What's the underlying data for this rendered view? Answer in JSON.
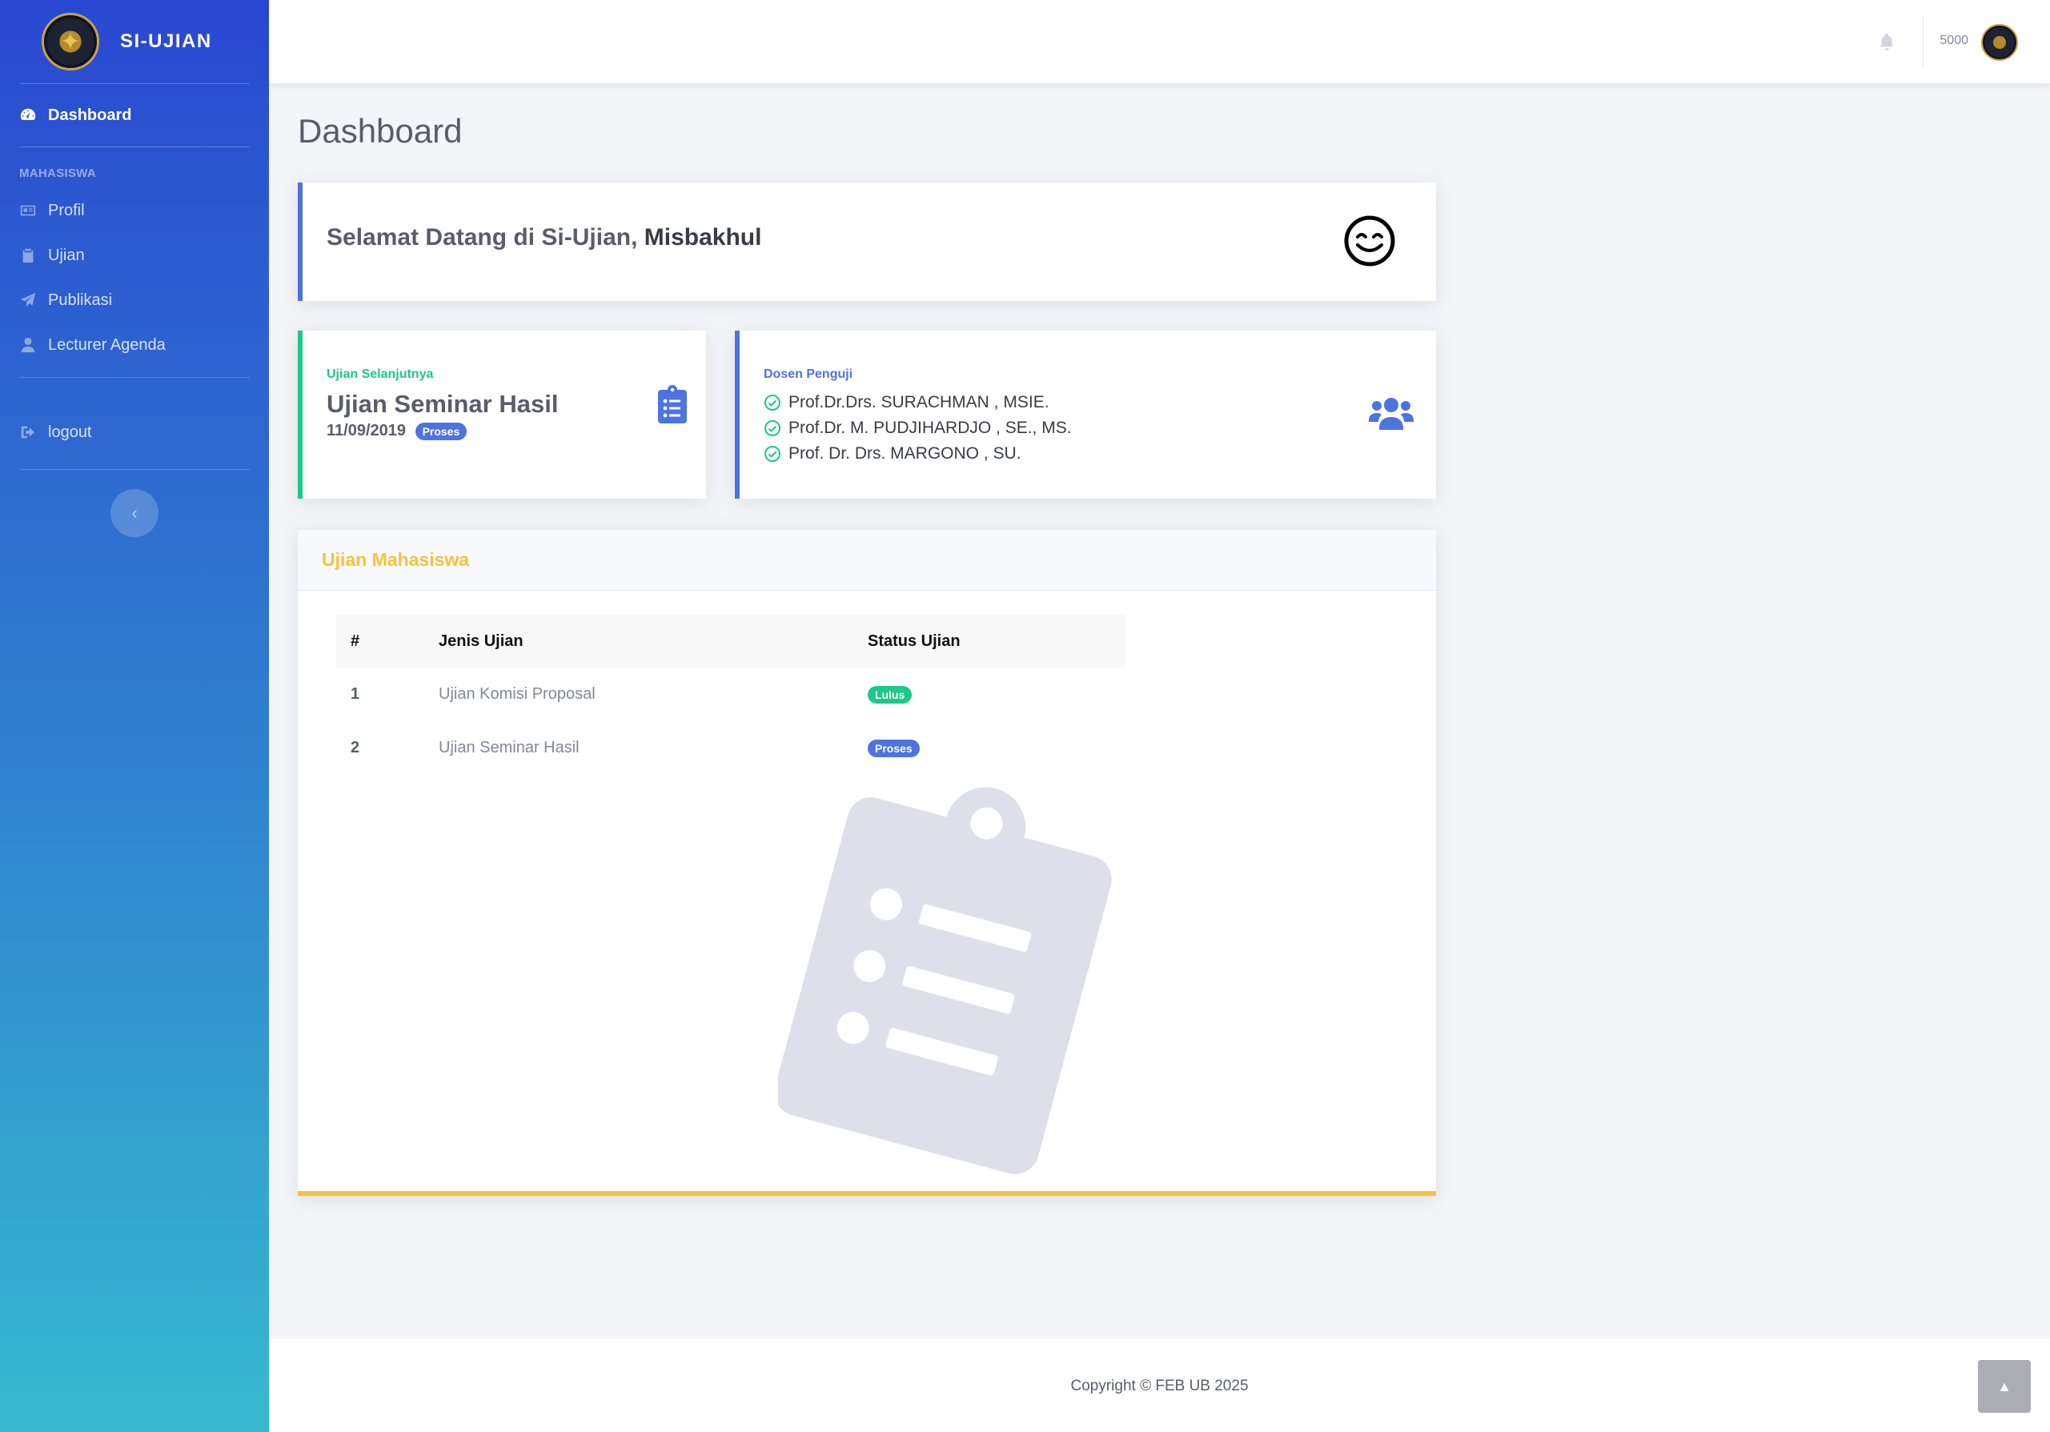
{
  "brand": {
    "name": "SI-UJIAN",
    "logo_icon": "university-emblem"
  },
  "sidebar": {
    "dashboard": {
      "label": "Dashboard",
      "icon": "tachometer-icon"
    },
    "heading": "MAHASISWA",
    "items": [
      {
        "label": "Profil",
        "icon": "id-card-icon"
      },
      {
        "label": "Ujian",
        "icon": "clipboard-icon"
      },
      {
        "label": "Publikasi",
        "icon": "paper-plane-icon"
      },
      {
        "label": "Lecturer Agenda",
        "icon": "user-icon"
      }
    ],
    "logout": {
      "label": "logout",
      "icon": "sign-out-icon"
    },
    "toggle_icon": "chevron-left-icon"
  },
  "topbar": {
    "user_name": "5000",
    "notification_icon": "bell-icon"
  },
  "page": {
    "title": "Dashboard"
  },
  "welcome": {
    "greeting": "Selamat Datang di Si-Ujian, ",
    "name": "Misbakhul",
    "icon": "smile-icon"
  },
  "next_exam": {
    "kicker": "Ujian Selanjutnya",
    "title": "Ujian Seminar Hasil",
    "date": "11/09/2019",
    "status": "Proses",
    "icon": "clipboard-list-icon"
  },
  "examiners": {
    "kicker": "Dosen Penguji",
    "list": [
      "Prof.Dr.Drs. SURACHMAN , MSIE.",
      "Prof.Dr. M. PUDJIHARDJO , SE., MS.",
      "Prof. Dr. Drs. MARGONO , SU."
    ],
    "icon": "users-icon"
  },
  "ujian_mahasiswa": {
    "title": "Ujian Mahasiswa",
    "columns": [
      "#",
      "Jenis Ujian",
      "Status Ujian"
    ],
    "rows": [
      {
        "num": "1",
        "jenis": "Ujian Komisi Proposal",
        "status": "Lulus",
        "status_color": "#1cc88a"
      },
      {
        "num": "2",
        "jenis": "Ujian Seminar Hasil",
        "status": "Proses",
        "status_color": "#4e73df"
      }
    ]
  },
  "footer": {
    "copyright": "Copyright © FEB UB 2025"
  },
  "colors": {
    "primary": "#4e73df",
    "success": "#1cc88a",
    "warning": "#f6c23e"
  }
}
